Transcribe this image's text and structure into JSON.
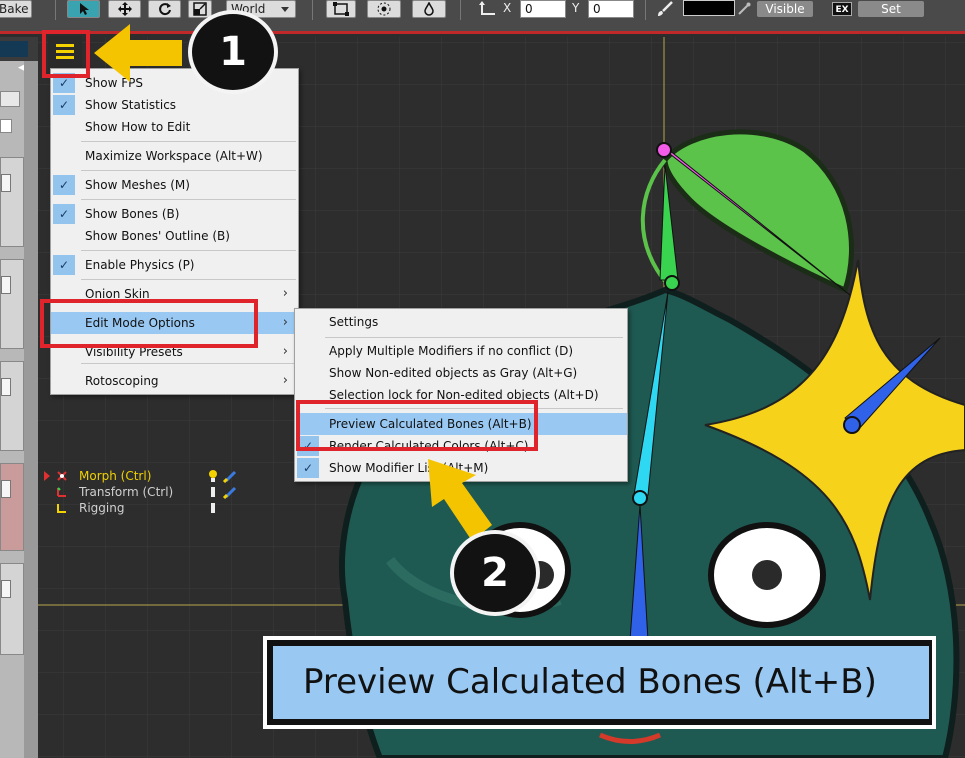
{
  "toolbar": {
    "bake_label": "Bake",
    "coord_space": "World",
    "x_label": "X",
    "x_value": "0",
    "y_label": "Y",
    "y_value": "0",
    "visible_label": "Visible",
    "ex_label": "EX",
    "set_label": "Set",
    "icons": [
      "select-arrow-icon",
      "move-icon",
      "rotate-icon",
      "scale-icon",
      "rect-select-icon",
      "point-icon",
      "droplet-icon",
      "axis-icon",
      "brush-icon",
      "eyedropper-icon"
    ]
  },
  "main_menu": {
    "items": [
      {
        "label": "Show FPS",
        "checked": true
      },
      {
        "label": "Show Statistics",
        "checked": true
      },
      {
        "label": "Show How to Edit",
        "checked": false
      },
      {
        "label": "Maximize Workspace (Alt+W)",
        "checked": false
      },
      {
        "label": "Show Meshes (M)",
        "checked": true
      },
      {
        "label": "Show Bones (B)",
        "checked": true
      },
      {
        "label": "Show Bones' Outline (B)",
        "checked": false
      },
      {
        "label": "Enable Physics (P)",
        "checked": true
      },
      {
        "label": "Onion Skin",
        "checked": false,
        "submenu": true
      },
      {
        "label": "Edit Mode Options",
        "checked": false,
        "submenu": true,
        "highlighted": true
      },
      {
        "label": "Visibility Presets",
        "checked": false,
        "submenu": true
      },
      {
        "label": "Rotoscoping",
        "checked": false,
        "submenu": true
      }
    ],
    "check_glyph": "✓",
    "submenu_glyph": "›"
  },
  "sub_menu": {
    "items": [
      {
        "label": "Settings",
        "checked": false
      },
      {
        "label": "Apply Multiple Modifiers if no conflict (D)",
        "checked": false
      },
      {
        "label": "Show Non-edited objects as Gray (Alt+G)",
        "checked": false
      },
      {
        "label": "Selection lock for Non-edited objects (Alt+D)",
        "checked": false
      },
      {
        "label": "Preview Calculated Bones (Alt+B)",
        "checked": false,
        "highlighted": true
      },
      {
        "label": "Render Calculated Colors (Alt+C)",
        "checked": true
      },
      {
        "label": "Show Modifier List (Alt+M)",
        "checked": true
      }
    ]
  },
  "layers": [
    {
      "label": "Morph (Ctrl)",
      "active": true
    },
    {
      "label": "Transform (Ctrl)",
      "active": false
    },
    {
      "label": "Rigging",
      "active": false
    }
  ],
  "annotations": {
    "step1": "1",
    "step2": "2",
    "zoom_label": "Preview Calculated Bones (Alt+B)",
    "accent_red": "#e0242b",
    "arrow_yellow": "#f5c400"
  },
  "colors": {
    "menu_highlight": "#99c9f3",
    "check_bg": "#93c4ee",
    "viewport_bg": "#2d2d2d"
  }
}
